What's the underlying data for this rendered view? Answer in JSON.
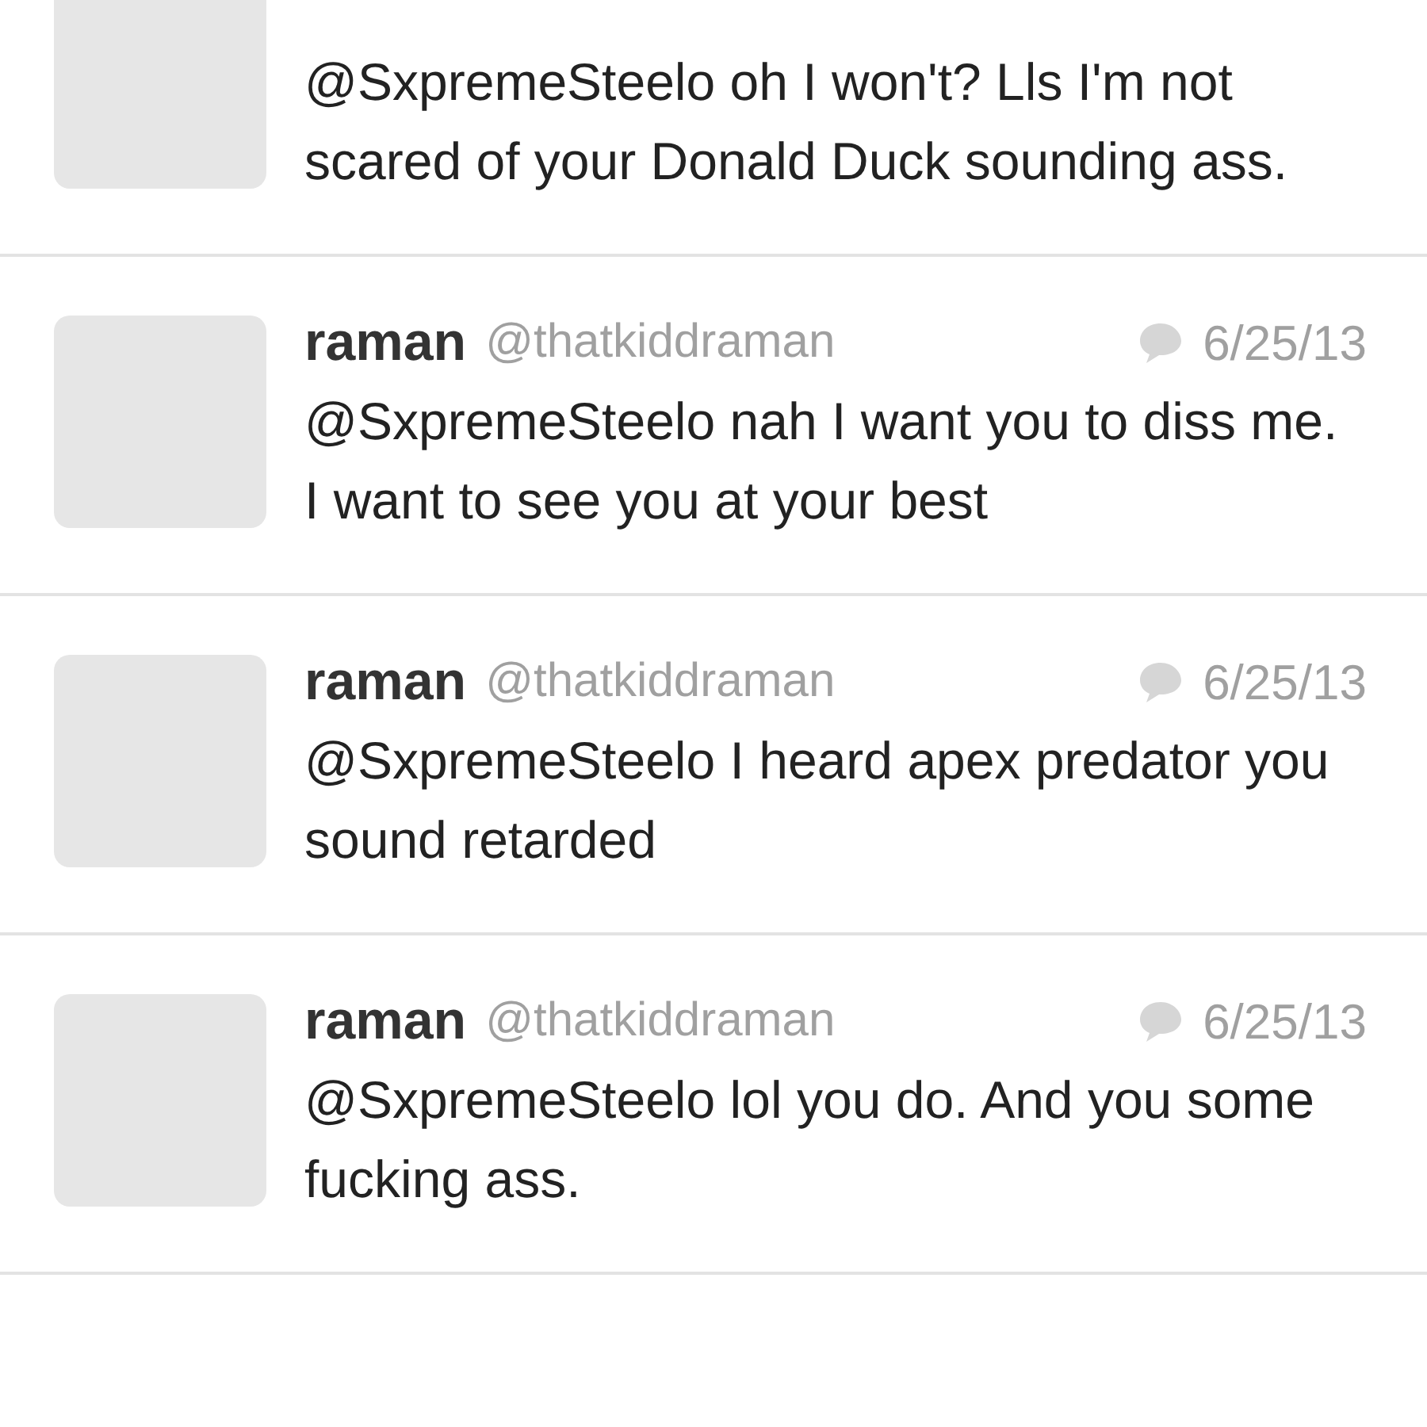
{
  "tweets": [
    {
      "text": "@SxpremeSteelo oh I won't? Lls I'm not scared of your Donald Duck sounding ass."
    },
    {
      "name": "raman",
      "handle": "@thatkiddraman",
      "date": "6/25/13",
      "text": "@SxpremeSteelo nah I want you to diss me. I want to see you at your best"
    },
    {
      "name": "raman",
      "handle": "@thatkiddraman",
      "date": "6/25/13",
      "text": "@SxpremeSteelo I heard apex predator you sound retarded"
    },
    {
      "name": "raman",
      "handle": "@thatkiddraman",
      "date": "6/25/13",
      "text": "@SxpremeSteelo lol you do. And you some fucking ass."
    }
  ]
}
